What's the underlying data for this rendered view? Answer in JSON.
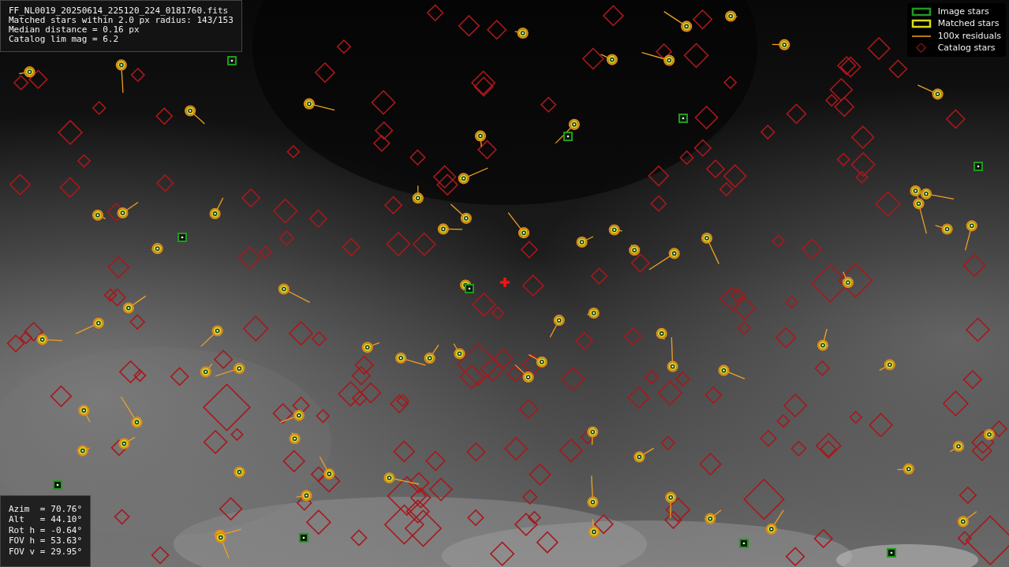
{
  "info_box": {
    "lines": [
      "FF_NL0019_20250614_225120_224_0181760.fits",
      "Matched stars within 2.0 px radius: 143/153",
      "Median distance = 0.16 px",
      "Catalog lim mag = 6.2"
    ]
  },
  "legend": [
    {
      "label": "Image stars"
    },
    {
      "kind": "matched",
      "label": "Matched stars"
    },
    {
      "kind": "residual",
      "label": "100x residuals"
    },
    {
      "kind": "catalog",
      "label": "Catalog stars"
    }
  ],
  "pointing": [
    {
      "label": "Azim  =",
      "value": "70.76°"
    },
    {
      "label": "Alt   =",
      "value": "44.10°"
    },
    {
      "label": "Rot h =",
      "value": "-0.64°"
    },
    {
      "label": "FOV h =",
      "value": "53.63°"
    },
    {
      "label": "FOV v =",
      "value": "29.95°"
    }
  ]
}
